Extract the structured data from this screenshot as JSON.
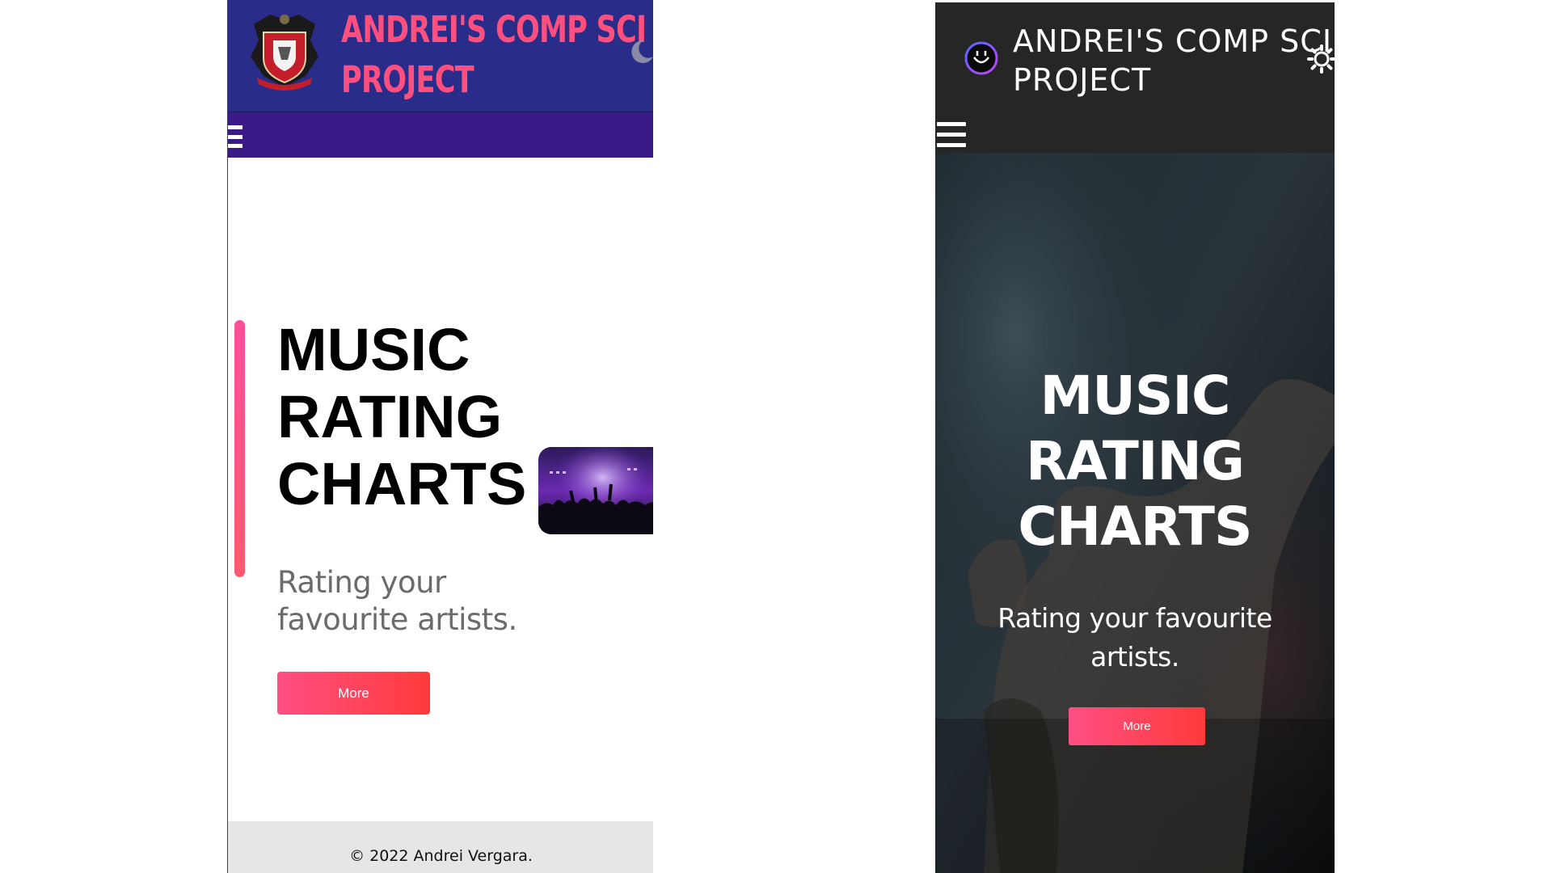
{
  "light_view": {
    "header": {
      "title_line1": "ANDREI'S COMP SCI",
      "title_line2": "PROJECT",
      "crest_icon": "school-crest-icon",
      "theme_toggle_icon": "moon-icon"
    },
    "nav": {
      "menu_icon": "hamburger-menu-icon"
    },
    "hero": {
      "heading_line1": "MUSIC",
      "heading_line2": "RATING",
      "heading_line3": "CHARTS",
      "subtitle": "Rating your favourite artists.",
      "button_label": "More",
      "thumbnail": "concert-crowd-image"
    },
    "footer": {
      "text": "© 2022 Andrei Vergara."
    },
    "colors": {
      "header_bg": "#2a2c8a",
      "nav_bg": "#3a1a86",
      "title_pink": "#ff4f7e",
      "accent_gradient_start": "#ff4f9a",
      "accent_gradient_end": "#ff3a3a",
      "footer_bg": "#e6e6e6"
    }
  },
  "dark_view": {
    "header": {
      "title_line1": "ANDREI'S COMP SCI",
      "title_line2": "PROJECT",
      "logo_icon": "smiley-logo-icon",
      "theme_toggle_icon": "sun-icon"
    },
    "nav": {
      "menu_icon": "hamburger-menu-icon"
    },
    "hero": {
      "heading_line1": "MUSIC",
      "heading_line2": "RATING",
      "heading_line3": "CHARTS",
      "subtitle": "Rating your favourite artists.",
      "button_label": "More",
      "background": "concert-crowd-background-image"
    },
    "colors": {
      "header_bg": "#262626",
      "button_gradient_start": "#ff4f83",
      "button_gradient_end": "#ff3a3a"
    }
  }
}
